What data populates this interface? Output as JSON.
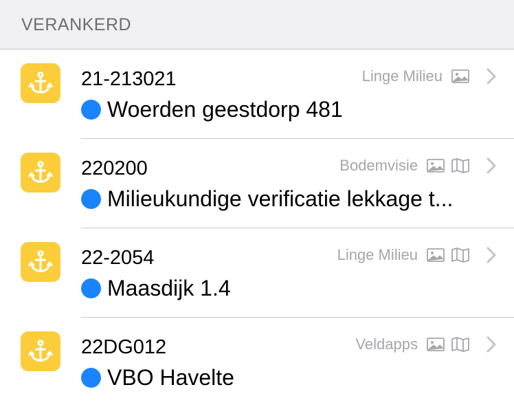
{
  "section": {
    "title": "VERANKERD"
  },
  "colors": {
    "tile": "#fccd3a",
    "status_dot": "#1a84ff",
    "secondary_text": "#a6a6ab"
  },
  "rows": [
    {
      "id": "21-213021",
      "title": "Woerden geestdorp 481",
      "source": "Linge Milieu",
      "icons": [
        "image-icon"
      ]
    },
    {
      "id": "220200",
      "title": "Milieukundige verificatie lekkage t...",
      "source": "Bodemvisie",
      "icons": [
        "image-icon",
        "map-icon"
      ]
    },
    {
      "id": "22-2054",
      "title": "Maasdijk 1.4",
      "source": "Linge Milieu",
      "icons": [
        "image-icon",
        "map-icon"
      ]
    },
    {
      "id": "22DG012",
      "title": "VBO Havelte",
      "source": "Veldapps",
      "icons": [
        "image-icon",
        "map-icon"
      ]
    }
  ]
}
